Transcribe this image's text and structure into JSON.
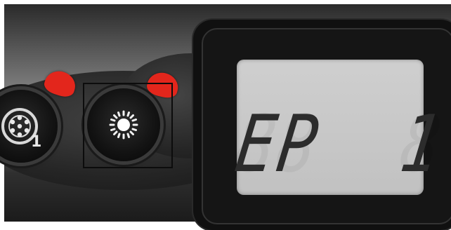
{
  "display": {
    "text": "EP  1"
  },
  "controls": {
    "program_button": {
      "icon": "program-dial-icon",
      "badge": "1"
    },
    "light_button": {
      "icon": "light-sun-icon"
    }
  },
  "colors": {
    "indicator_led": "#e3261c",
    "lcd_background": "#c8c8c8",
    "lcd_segments": "#2c2c2c"
  }
}
